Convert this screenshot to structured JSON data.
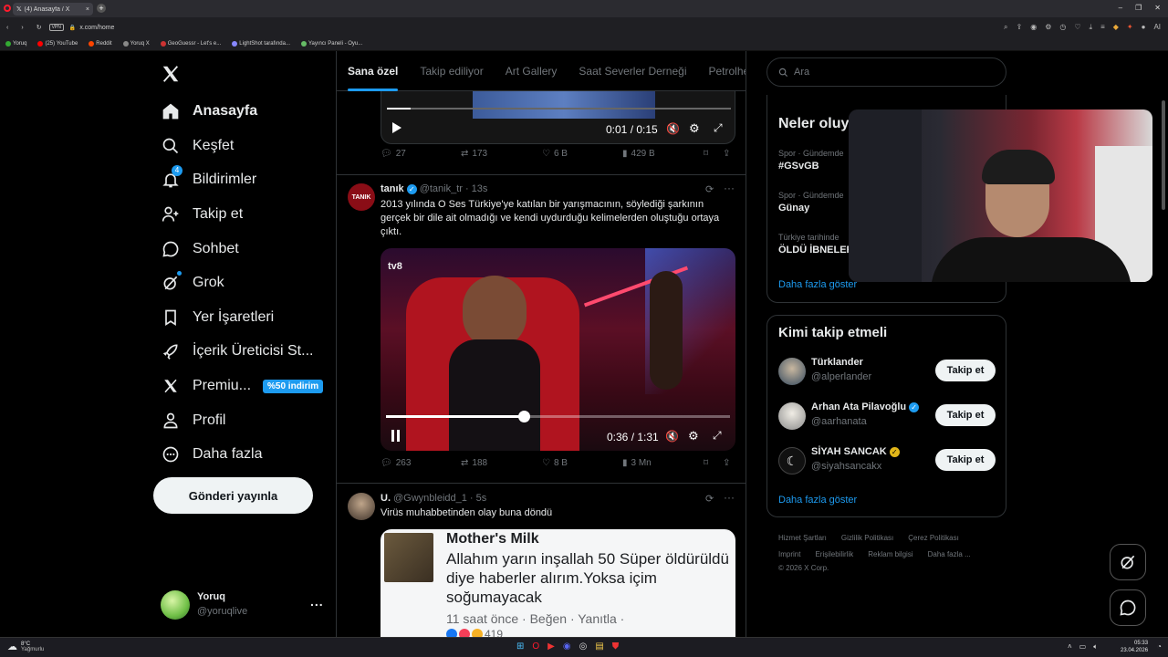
{
  "browser": {
    "tab_title": "(4) Anasayfa / X",
    "url": "x.com/home",
    "vpn_badge": "VPN",
    "bookmarks": [
      "Yoruq",
      "(25) YouTube",
      "Reddit",
      "Yoruq X",
      "GeoGuessr - Let's e...",
      "LightShot tarafında...",
      "Yayıncı Paneli - Oyu..."
    ]
  },
  "nav": {
    "items": [
      {
        "label": "Anasayfa",
        "icon": "home-icon"
      },
      {
        "label": "Keşfet",
        "icon": "search-icon"
      },
      {
        "label": "Bildirimler",
        "icon": "bell-icon",
        "badge": "4"
      },
      {
        "label": "Takip et",
        "icon": "add-person-icon"
      },
      {
        "label": "Sohbet",
        "icon": "chat-icon"
      },
      {
        "label": "Grok",
        "icon": "grok-icon"
      },
      {
        "label": "Yer İşaretleri",
        "icon": "bookmark-icon"
      },
      {
        "label": "İçerik Üreticisi St...",
        "icon": "rocket-icon"
      },
      {
        "label": "Premiu...",
        "icon": "x-logo-icon",
        "badge": "%50 indirim"
      },
      {
        "label": "Profil",
        "icon": "person-icon"
      },
      {
        "label": "Daha fazla",
        "icon": "more-circle-icon"
      }
    ],
    "post_button": "Gönderi yayınla",
    "user": {
      "name": "Yoruq",
      "handle": "@yoruqlive",
      "more": "..."
    }
  },
  "feed": {
    "tabs": [
      "Sana özel",
      "Takip ediliyor",
      "Art Gallery",
      "Saat Severler Derneği",
      "Petrolhea"
    ],
    "post1": {
      "video_time": "0:01 / 0:15",
      "progress": 0.07,
      "actions": {
        "replies": "27",
        "reposts": "173",
        "likes": "6 B",
        "views": "429 B"
      }
    },
    "post2": {
      "avatar_text": "TANIK",
      "name": "tanık",
      "handle": "@tanik_tr",
      "time": "· 13s",
      "text": "2013 yılında O Ses Türkiye'ye katılan bir yarışmacının, söylediği şarkının gerçek bir dile ait olmadığı ve kendi uydurduğu kelimelerden oluştuğu ortaya çıktı.",
      "video_logo": "tv8",
      "video_time": "0:36 / 1:31",
      "progress": 0.4,
      "actions": {
        "replies": "263",
        "reposts": "188",
        "likes": "8 B",
        "views": "3 Mn"
      }
    },
    "post3": {
      "name": "U.",
      "handle": "@Gwynbleidd_1",
      "time": "· 5s",
      "text": "Virüs muhabbetinden olay buna döndü",
      "image": {
        "title": "Mother's Milk",
        "comment": "Allahım yarın inşallah 50 Süper öldürüldü diye haberler alırım.Yoksa içim soğumayacak",
        "meta": "11 saat önce · Beğen · Yanıtla ·",
        "reactions": "419"
      }
    }
  },
  "right": {
    "search_placeholder": "Ara",
    "trends": {
      "title": "Neler oluy",
      "items": [
        {
          "category": "Spor · Gündemde",
          "name": "#GSvGB"
        },
        {
          "category": "Spor · Gündemde",
          "name": "Günay"
        },
        {
          "category": "Türkiye tarihinde",
          "name": "ÖLDÜ İBNELER"
        }
      ],
      "more": "Daha fazla göster"
    },
    "who_to_follow": {
      "title": "Kimi takip etmeli",
      "items": [
        {
          "name": "Türklander",
          "handle": "@alperlander",
          "button": "Takip et"
        },
        {
          "name": "Arhan Ata Pilavoğlu",
          "handle": "@aarhanata",
          "button": "Takip et"
        },
        {
          "name": "SİYAH SANCAK",
          "handle": "@siyahsancakx",
          "button": "Takip et"
        }
      ],
      "more": "Daha fazla göster"
    },
    "footer": {
      "row1": [
        "Hizmet Şartları",
        "Gizlilik Politikası",
        "Çerez Politikası"
      ],
      "row2": [
        "Imprint",
        "Erişilebilirlik",
        "Reklam bilgisi",
        "Daha fazla ..."
      ],
      "copyright": "© 2026 X Corp."
    }
  },
  "taskbar": {
    "weather_temp": "8°C",
    "weather_desc": "Yağmurlu",
    "time": "05:33",
    "date": "23.04.2026"
  },
  "colors": {
    "accent": "#1d9bf0",
    "background": "#000000",
    "border": "#2f3336",
    "muted": "#71767b"
  }
}
